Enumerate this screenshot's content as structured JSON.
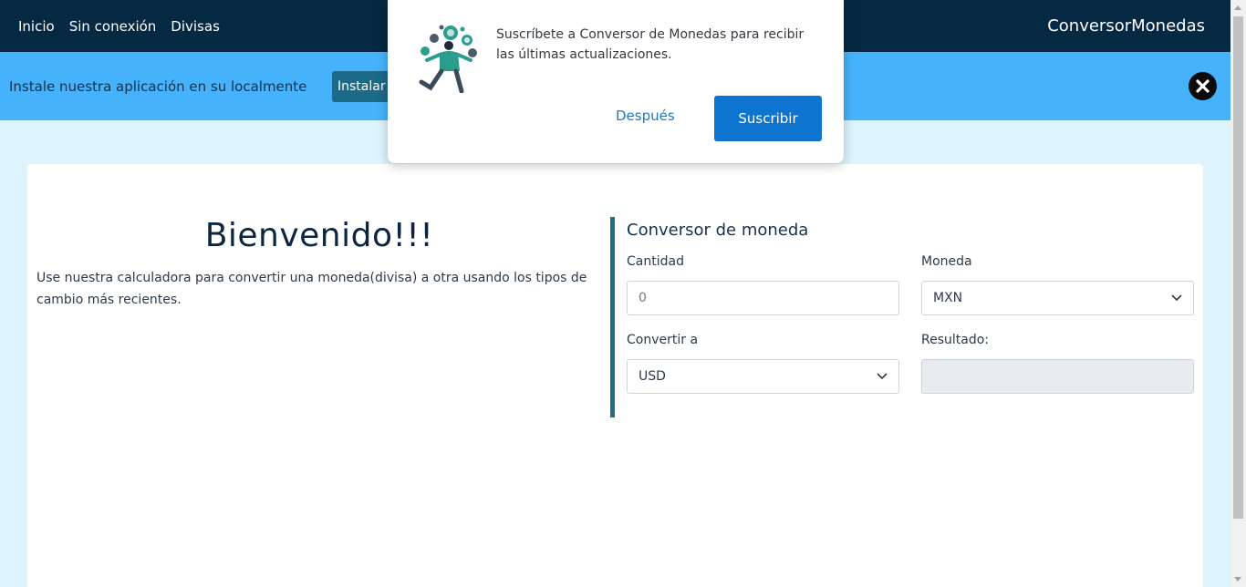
{
  "nav": {
    "links": [
      "Inicio",
      "Sin conexión",
      "Divisas"
    ],
    "brand": "ConversorMonedas"
  },
  "install_bar": {
    "text": "Instale nuestra aplicación en su localmente",
    "button": "Instalar"
  },
  "main": {
    "welcome_title": "Bienvenido!!!",
    "welcome_text": "Use nuestra calculadora para convertir una moneda(divisa) a otra usando los tipos de cambio más recientes."
  },
  "converter": {
    "title": "Conversor de moneda",
    "amount_label": "Cantidad",
    "amount_placeholder": "0",
    "currency_label": "Moneda",
    "currency_value": "MXN",
    "convert_to_label": "Convertir a",
    "convert_to_value": "USD",
    "result_label": "Resultado:",
    "result_value": ""
  },
  "popup": {
    "message": "Suscríbete a Conversor de Monedas para recibir las últimas actualizaciones.",
    "later": "Después",
    "subscribe": "Suscribir"
  },
  "colors": {
    "navbar": "#062943",
    "install_bar": "#46b2fb",
    "page_bg": "#ddf4fd",
    "accent": "#1f6e86",
    "subscribe_button": "#0d74cf"
  }
}
